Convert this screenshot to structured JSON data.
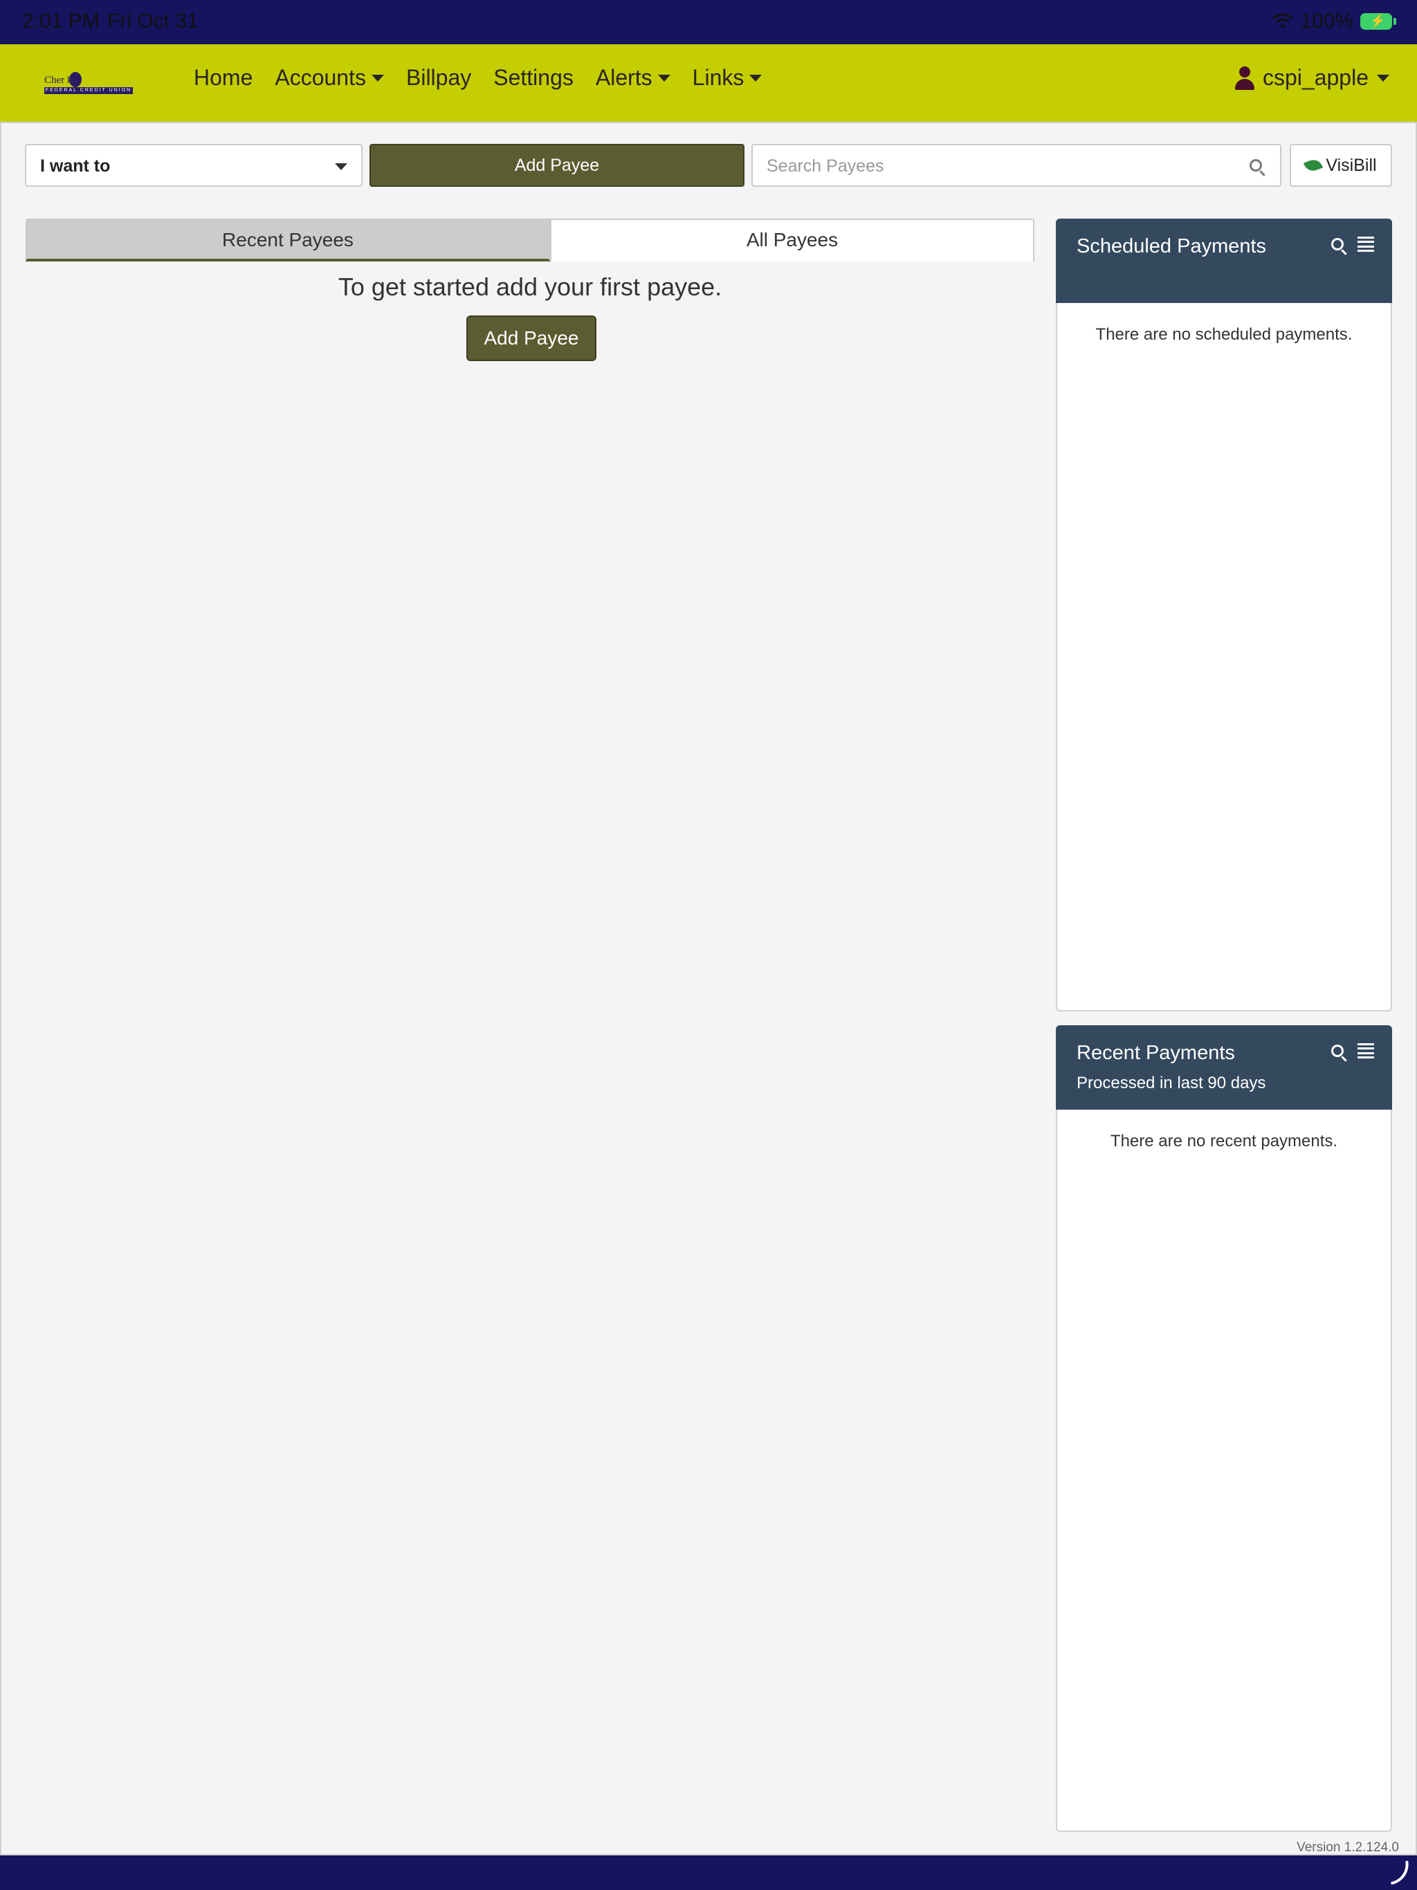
{
  "status_bar": {
    "time": "2:01 PM",
    "date": "Fri Oct 31",
    "battery": "100%"
  },
  "brand": {
    "logo_text": "Cher   kee",
    "logo_subtext": "FEDERAL CREDIT UNION"
  },
  "nav": {
    "items": [
      {
        "label": "Home",
        "has_dropdown": false
      },
      {
        "label": "Accounts",
        "has_dropdown": true
      },
      {
        "label": "Billpay",
        "has_dropdown": false
      },
      {
        "label": "Settings",
        "has_dropdown": false
      },
      {
        "label": "Alerts",
        "has_dropdown": true
      },
      {
        "label": "Links",
        "has_dropdown": true
      }
    ],
    "user": "cspi_apple"
  },
  "toolbar": {
    "i_want_to": "I want to",
    "add_payee": "Add Payee",
    "search_placeholder": "Search Payees",
    "visibill": "VisiBill"
  },
  "tabs": {
    "recent": "Recent Payees",
    "all": "All Payees",
    "active": "recent"
  },
  "main": {
    "empty_message": "To get started add your first payee.",
    "add_payee": "Add Payee"
  },
  "scheduled": {
    "title": "Scheduled Payments",
    "empty": "There are no scheduled payments."
  },
  "recent": {
    "title": "Recent Payments",
    "subtitle": "Processed in last 90 days",
    "empty": "There are no recent payments."
  },
  "footer": {
    "version": "Version 1.2.124.0"
  },
  "colors": {
    "navbar": "#c4ce00",
    "system_bar": "#16135f",
    "primary_button": "#5c5c32",
    "panel_header": "#34495e"
  }
}
